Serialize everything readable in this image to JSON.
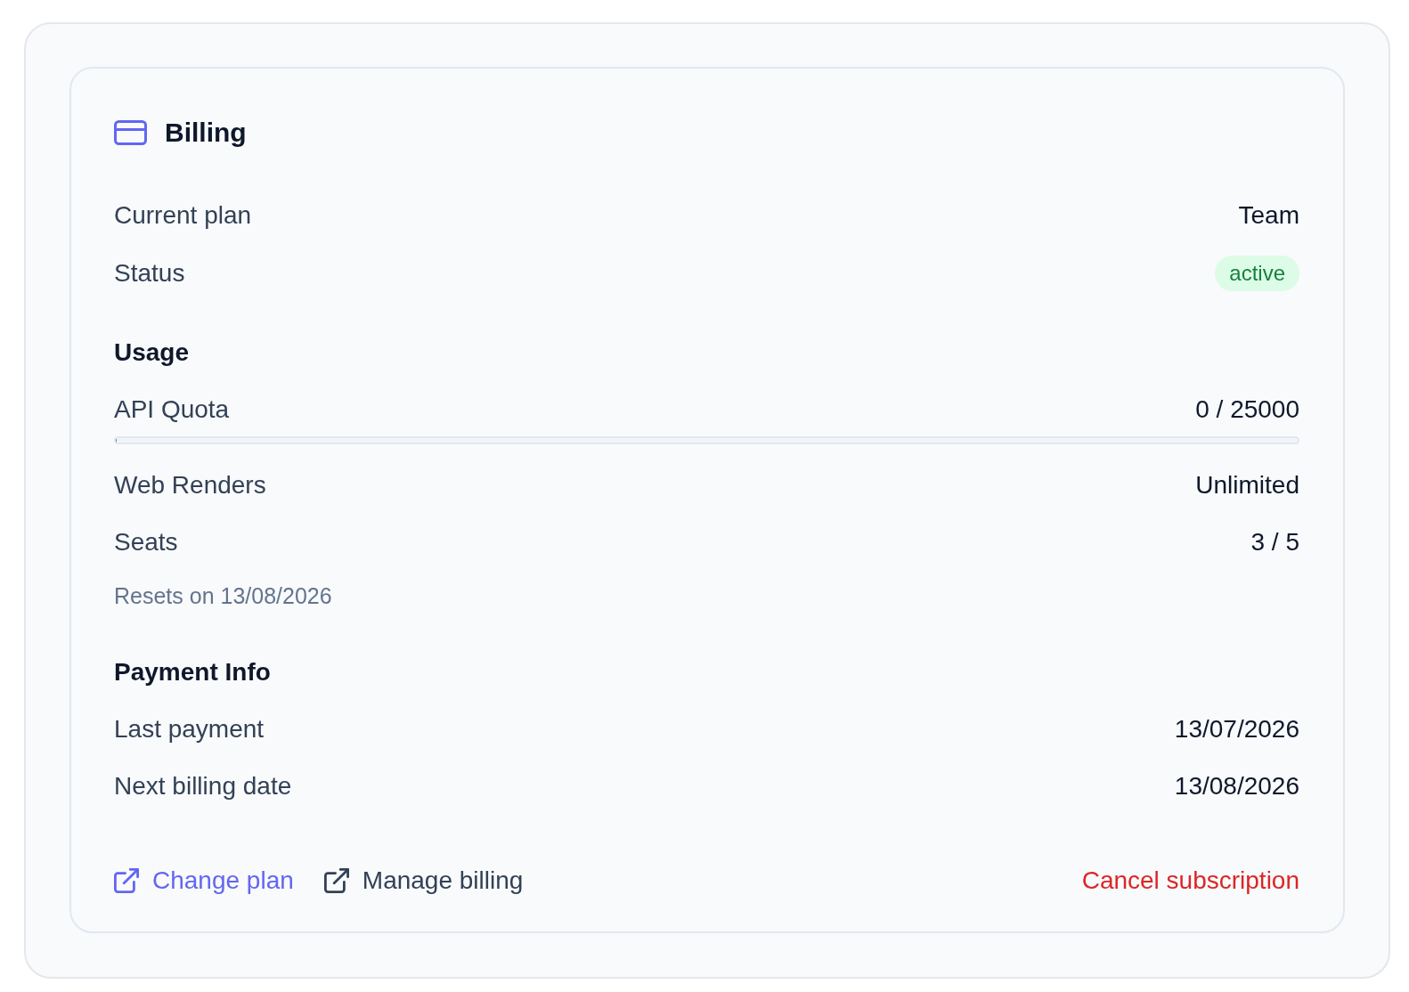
{
  "header": {
    "title": "Billing"
  },
  "plan": {
    "rows": [
      {
        "kind": "text",
        "label": "Current plan",
        "value": "Team"
      },
      {
        "kind": "badge",
        "label": "Status",
        "value": "active"
      }
    ]
  },
  "usage": {
    "title": "Usage",
    "items": [
      {
        "kind": "meter",
        "label": "API Quota",
        "value": "0 / 25000",
        "level": 0
      },
      {
        "kind": "text",
        "label": "Web Renders",
        "value": "Unlimited"
      },
      {
        "kind": "text",
        "label": "Seats",
        "value": "3 / 5"
      }
    ],
    "note": "Resets on 13/08/2026"
  },
  "payment": {
    "title": "Payment Info",
    "rows": [
      {
        "kind": "text",
        "label": "Last payment",
        "value": "13/07/2026"
      },
      {
        "kind": "text",
        "label": "Next billing date",
        "value": "13/08/2026"
      }
    ]
  },
  "actions": [
    {
      "kind": "primary",
      "label": "Change plan",
      "icon": true
    },
    {
      "kind": "secondary",
      "label": "Manage billing",
      "icon": true
    },
    {
      "kind": "danger",
      "label": "Cancel subscription",
      "icon": false
    }
  ]
}
